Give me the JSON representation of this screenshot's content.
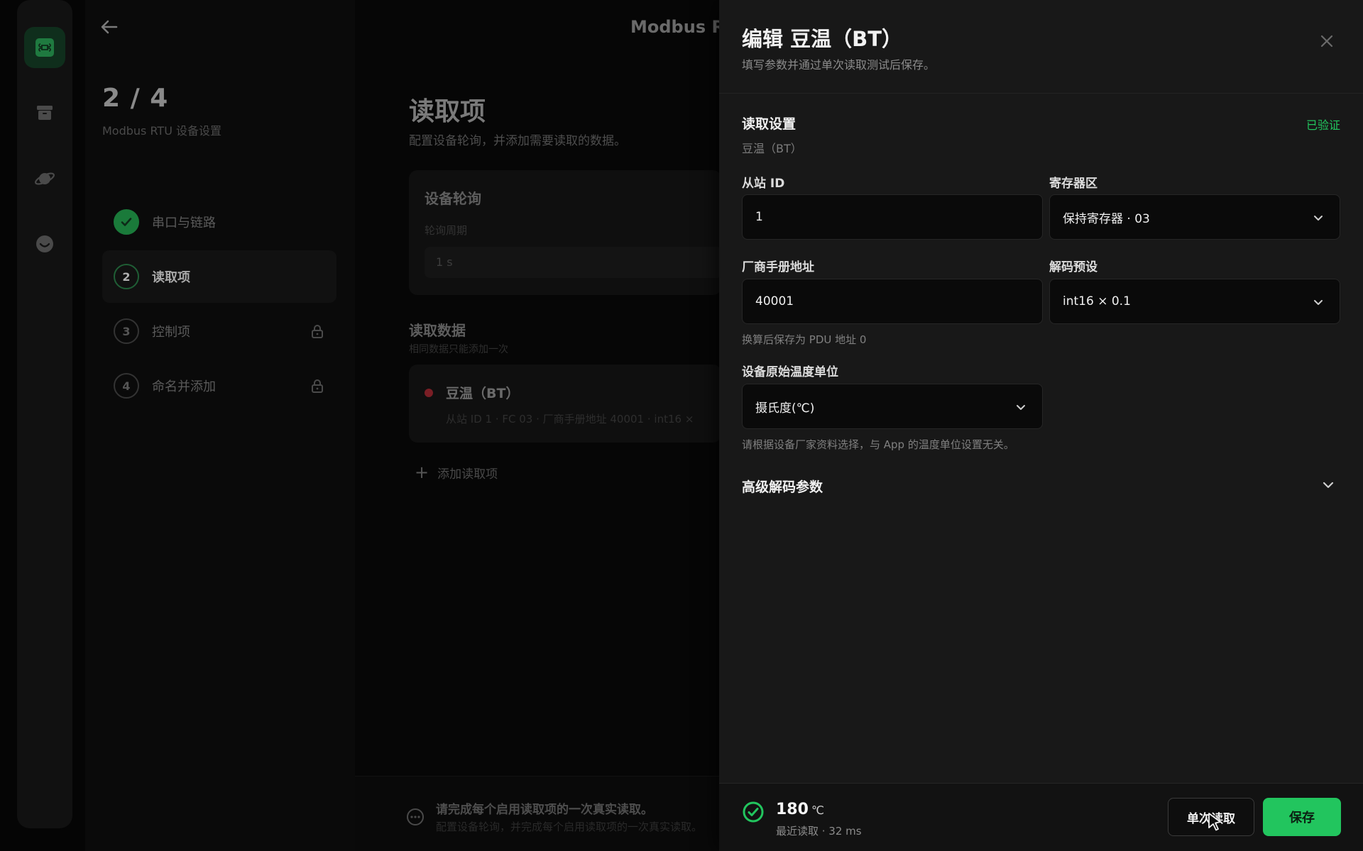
{
  "colors": {
    "accent": "#22c55e",
    "drawer_bg": "#181818",
    "input_bg": "#0a0a0a",
    "danger_dot": "#7a1e25"
  },
  "rail": {
    "items": [
      {
        "icon": "command-icon",
        "active": true
      },
      {
        "icon": "archive-icon",
        "active": false
      },
      {
        "icon": "planet-icon",
        "active": false
      },
      {
        "icon": "smile-icon",
        "active": false
      }
    ]
  },
  "wizard": {
    "step_count": "2 / 4",
    "subtitle": "Modbus RTU 设备设置",
    "steps": [
      {
        "num": "✓",
        "label": "串口与链路",
        "state": "done",
        "locked": false
      },
      {
        "num": "2",
        "label": "读取项",
        "state": "current",
        "locked": false
      },
      {
        "num": "3",
        "label": "控制项",
        "state": "locked",
        "locked": true
      },
      {
        "num": "4",
        "label": "命名并添加",
        "state": "locked",
        "locked": true
      }
    ]
  },
  "main": {
    "top_title": "Modbus RT",
    "section_title": "读取项",
    "section_sub": "配置设备轮询，并添加需要读取的数据。",
    "poll": {
      "title": "设备轮询",
      "label": "轮询周期",
      "value": "1 s"
    },
    "read_data": {
      "title": "读取数据",
      "sub": "相同数据只能添加一次",
      "item": {
        "name": "豆温（BT）",
        "meta": "从站 ID 1  ·  FC 03  ·  厂商手册地址 40001  ·  int16 ×"
      }
    },
    "add_read": "添加读取项",
    "footer": {
      "title": "请完成每个启用读取项的一次真实读取。",
      "sub": "配置设备轮询，并完成每个启用读取项的一次真实读取。"
    }
  },
  "drawer": {
    "title": "编辑 豆温（BT）",
    "subtitle": "填写参数并通过单次读取测试后保存。",
    "section": "读取设置",
    "verified": "已验证",
    "section_sub": "豆温（BT）",
    "fields": {
      "slave_id": {
        "label": "从站 ID",
        "value": "1"
      },
      "register_area": {
        "label": "寄存器区",
        "value": "保持寄存器 · 03"
      },
      "manual_address": {
        "label": "厂商手册地址",
        "value": "40001",
        "hint": "换算后保存为 PDU 地址 0"
      },
      "decode_preset": {
        "label": "解码预设",
        "value": "int16 × 0.1"
      },
      "temp_unit": {
        "label": "设备原始温度单位",
        "value": "摄氏度(℃)",
        "hint": "请根据设备厂家资料选择，与 App 的温度单位设置无关。"
      }
    },
    "advanced": "高级解码参数",
    "footer": {
      "value": "180",
      "unit": "℃",
      "meta": "最近读取 · 32 ms",
      "read_button": "单次读取",
      "save_button": "保存"
    }
  }
}
